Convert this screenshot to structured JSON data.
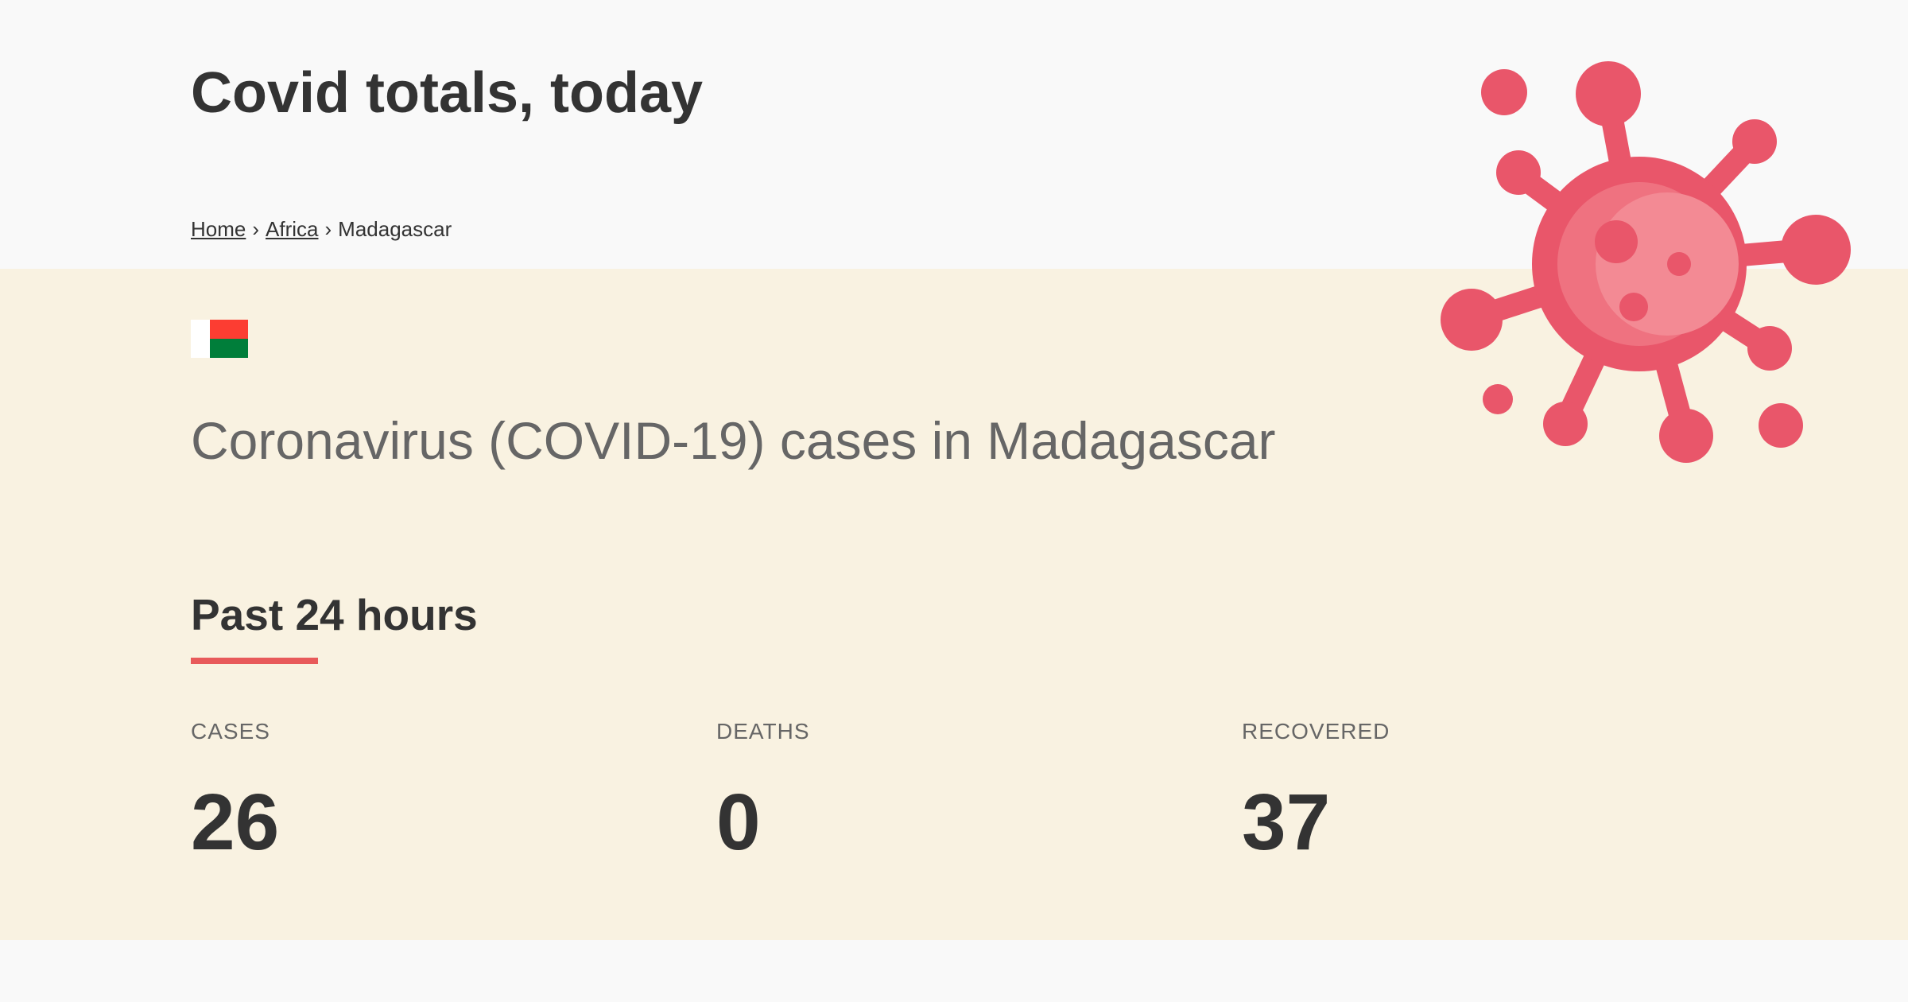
{
  "header": {
    "title": "Covid totals, today"
  },
  "breadcrumb": {
    "home": "Home",
    "region": "Africa",
    "current": "Madagascar",
    "separator": "›"
  },
  "country": {
    "flag_icon": "madagascar-flag-icon",
    "heading": "Coronavirus (COVID-19) cases in Madagascar"
  },
  "section": {
    "title": "Past 24 hours"
  },
  "stats": {
    "cases": {
      "label": "CASES",
      "value": "26"
    },
    "deaths": {
      "label": "DEATHS",
      "value": "0"
    },
    "recovered": {
      "label": "RECOVERED",
      "value": "37"
    }
  },
  "illustration": {
    "icon": "virus-icon"
  },
  "colors": {
    "accent": "#e85a5a",
    "virus": "#e9566a",
    "band_background": "#f9f2e1",
    "page_background": "#f9f9f9"
  }
}
